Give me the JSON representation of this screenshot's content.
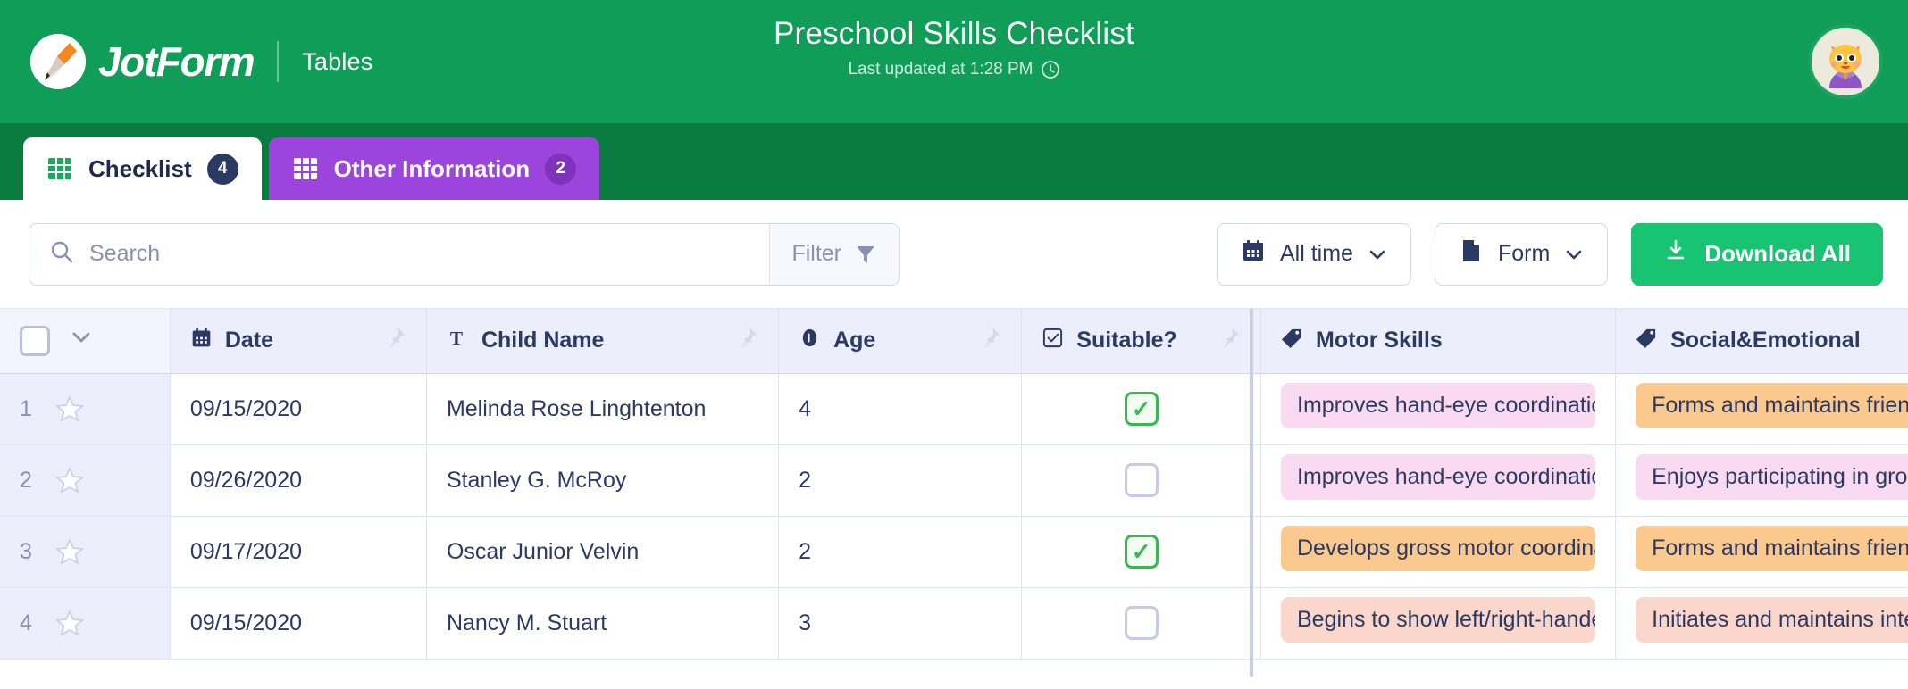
{
  "header": {
    "brand_name": "JotForm",
    "brand_icon": "jotform-pencil-logo",
    "product": "Tables",
    "title": "Preschool Skills Checklist",
    "last_updated": "Last updated at 1:28 PM",
    "clock_icon": "clock-icon",
    "avatar_icon": "cat-avatar",
    "green": "#0f9d58",
    "tabstrip_green": "#0b7c3f"
  },
  "tabs": [
    {
      "label": "Checklist",
      "count": "4",
      "icon": "grid-icon",
      "active": true,
      "color": "#ffffff"
    },
    {
      "label": "Other Information",
      "count": "2",
      "icon": "grid-icon",
      "active": false,
      "color": "#9c45dd"
    }
  ],
  "toolbar": {
    "search_placeholder": "Search",
    "search_value": "",
    "search_icon": "search-icon",
    "filter_label": "Filter",
    "filter_icon": "filter-icon",
    "date_range_label": "All time",
    "date_range_icon": "calendar-icon",
    "source_label": "Form",
    "source_icon": "document-icon",
    "download_label": "Download All",
    "download_icon": "download-icon",
    "download_color": "#18c472"
  },
  "table": {
    "columns": [
      {
        "label": "",
        "icon": "checkbox-icon",
        "type": "select"
      },
      {
        "label": "Date",
        "icon": "calendar-icon",
        "pin": "pin-icon"
      },
      {
        "label": "Child Name",
        "icon": "text-icon",
        "pin": "pin-icon"
      },
      {
        "label": "Age",
        "icon": "number-icon",
        "pin": "pin-icon"
      },
      {
        "label": "Suitable?",
        "icon": "checkbox-icon",
        "pin": "pin-icon"
      },
      {
        "label": "Motor Skills",
        "icon": "tag-icon",
        "pin": ""
      },
      {
        "label": "Social&Emotional",
        "icon": "tag-icon",
        "pin": ""
      }
    ],
    "rows": [
      {
        "num": "1",
        "date": "09/15/2020",
        "name": "Melinda Rose Linghtenton",
        "age": "4",
        "suitable": true,
        "motor": {
          "text": "Improves hand-eye coordination",
          "color": "#f9daf0"
        },
        "social": {
          "text": "Forms and maintains friendships",
          "color": "#fbc88d"
        }
      },
      {
        "num": "2",
        "date": "09/26/2020",
        "name": "Stanley G. McRoy",
        "age": "2",
        "suitable": false,
        "motor": {
          "text": "Improves hand-eye coordination",
          "color": "#f9daf0"
        },
        "social": {
          "text": "Enjoys participating in group activities",
          "color": "#f9daf0"
        }
      },
      {
        "num": "3",
        "date": "09/17/2020",
        "name": "Oscar Junior Velvin",
        "age": "2",
        "suitable": true,
        "motor": {
          "text": "Develops gross motor coordination",
          "color": "#fbc88d"
        },
        "social": {
          "text": "Forms and maintains friendships",
          "color": "#fbc88d"
        }
      },
      {
        "num": "4",
        "date": "09/15/2020",
        "name": "Nancy M. Stuart",
        "age": "3",
        "suitable": false,
        "motor": {
          "text": "Begins to show left/right-handedness",
          "color": "#fbd6cb"
        },
        "social": {
          "text": "Initiates and maintains interactions",
          "color": "#fbd6cb"
        }
      }
    ]
  }
}
